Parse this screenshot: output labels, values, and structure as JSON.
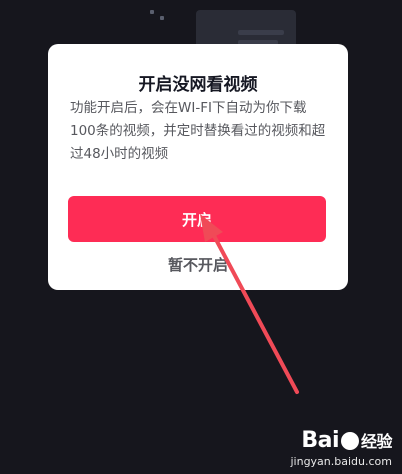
{
  "dialog": {
    "title": "开启没网看视频",
    "description": "功能开启后，会在WI-FI下自动为你下载100条的视频，并定时替换看过的视频和超过48小时的视频",
    "primary_button": "开启",
    "secondary_button": "暂不开启"
  },
  "watermark": {
    "brand_left": "Bai",
    "brand_right": "经验",
    "url": "jingyan.baidu.com"
  },
  "colors": {
    "accent": "#fe2c55",
    "arrow": "#f04a57",
    "background": "#16161d"
  }
}
